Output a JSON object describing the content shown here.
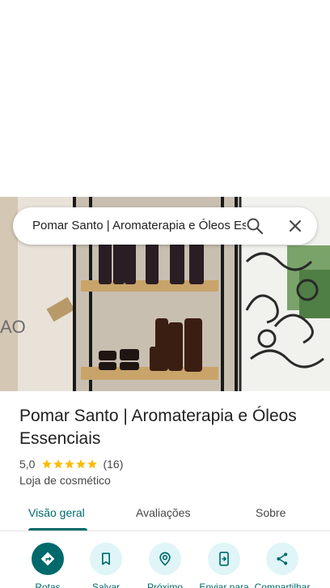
{
  "search": {
    "query": "Pomar Santo | Aromaterapia e Óleos Essenciais"
  },
  "place": {
    "name": "Pomar Santo | Aromaterapia e Óleos Essenciais",
    "rating": "5,0",
    "stars": 5,
    "review_count": "(16)",
    "category": "Loja de cosmético"
  },
  "tabs": [
    {
      "label": "Visão geral",
      "active": true
    },
    {
      "label": "Avaliações",
      "active": false
    },
    {
      "label": "Sobre",
      "active": false
    }
  ],
  "actions": [
    {
      "label": "Rotas",
      "icon": "directions-icon"
    },
    {
      "label": "Salvar",
      "icon": "bookmark-icon"
    },
    {
      "label": "Próximo",
      "icon": "nearby-icon"
    },
    {
      "label": "Enviar para",
      "icon": "send-to-phone-icon"
    },
    {
      "label": "Compartilhar",
      "icon": "share-icon"
    }
  ],
  "colors": {
    "accent": "#00696b",
    "accent_light": "#dff5f7",
    "star": "#fbbc04"
  }
}
